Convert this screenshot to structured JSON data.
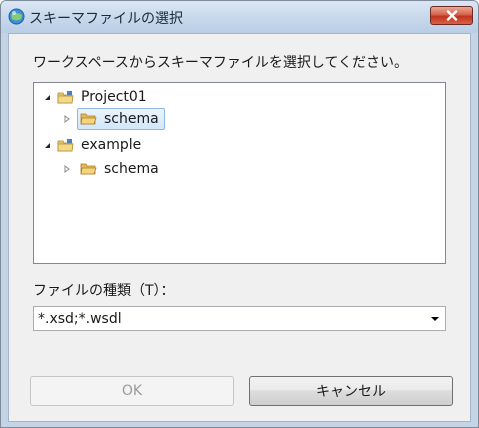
{
  "window": {
    "title": "スキーマファイルの選択"
  },
  "dialog": {
    "instruction": "ワークスペースからスキーマファイルを選択してください。",
    "tree": {
      "nodes": [
        {
          "label": "Project01",
          "expanded": true,
          "icon": "project-folder-icon"
        },
        {
          "label": "schema",
          "expanded": false,
          "icon": "folder-icon",
          "selected": true
        },
        {
          "label": "example",
          "expanded": true,
          "icon": "project-folder-icon"
        },
        {
          "label": "schema",
          "expanded": false,
          "icon": "folder-icon",
          "selected": false
        }
      ]
    },
    "file_type_label": "ファイルの種類（T）：",
    "file_type_value": "*.xsd;*.wsdl",
    "ok_label": "OK",
    "ok_enabled": false,
    "cancel_label": "キャンセル"
  },
  "colors": {
    "selection": "#d2e7fb",
    "close_button": "#c0341c",
    "folder": "#e8b84a"
  }
}
